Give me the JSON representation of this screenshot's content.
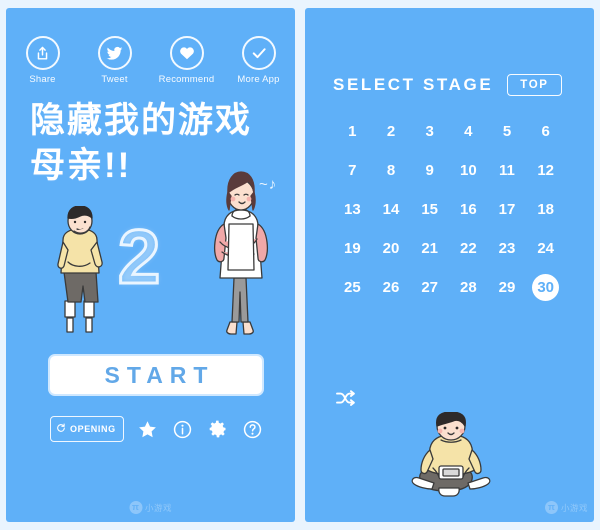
{
  "colors": {
    "background": "#5fb0f8",
    "page_background": "#e9f4fe",
    "accent_white": "#ffffff",
    "start_text": "#62a8e8",
    "selected_stage_text": "#5fb0f8"
  },
  "left_screen": {
    "social": [
      {
        "label": "Share",
        "icon": "share-upload-icon"
      },
      {
        "label": "Tweet",
        "icon": "twitter-bird-icon"
      },
      {
        "label": "Recommend",
        "icon": "heart-icon"
      },
      {
        "label": "More App",
        "icon": "check-circle-icon"
      }
    ],
    "title_line_1": "隐藏我的游戏",
    "title_line_2": "母亲!!",
    "sequel_number": "2",
    "music_note": "~♪",
    "start_label": "START",
    "bottom_bar": {
      "opening_label": "OPENING",
      "opening_icon": "refresh-icon",
      "icons": [
        {
          "name": "star-icon"
        },
        {
          "name": "info-icon"
        },
        {
          "name": "gear-icon"
        },
        {
          "name": "help-question-icon"
        }
      ]
    },
    "characters": [
      {
        "name": "boy-thinking-illustration"
      },
      {
        "name": "mother-apron-illustration"
      }
    ]
  },
  "right_screen": {
    "header_title": "SELECT STAGE",
    "top_button_label": "TOP",
    "stages": [
      {
        "number": "1",
        "selected": false
      },
      {
        "number": "2",
        "selected": false
      },
      {
        "number": "3",
        "selected": false
      },
      {
        "number": "4",
        "selected": false
      },
      {
        "number": "5",
        "selected": false
      },
      {
        "number": "6",
        "selected": false
      },
      {
        "number": "7",
        "selected": false
      },
      {
        "number": "8",
        "selected": false
      },
      {
        "number": "9",
        "selected": false
      },
      {
        "number": "10",
        "selected": false
      },
      {
        "number": "11",
        "selected": false
      },
      {
        "number": "12",
        "selected": false
      },
      {
        "number": "13",
        "selected": false
      },
      {
        "number": "14",
        "selected": false
      },
      {
        "number": "15",
        "selected": false
      },
      {
        "number": "16",
        "selected": false
      },
      {
        "number": "17",
        "selected": false
      },
      {
        "number": "18",
        "selected": false
      },
      {
        "number": "19",
        "selected": false
      },
      {
        "number": "20",
        "selected": false
      },
      {
        "number": "21",
        "selected": false
      },
      {
        "number": "22",
        "selected": false
      },
      {
        "number": "23",
        "selected": false
      },
      {
        "number": "24",
        "selected": false
      },
      {
        "number": "25",
        "selected": false
      },
      {
        "number": "26",
        "selected": false
      },
      {
        "number": "27",
        "selected": false
      },
      {
        "number": "28",
        "selected": false
      },
      {
        "number": "29",
        "selected": false
      },
      {
        "number": "30",
        "selected": true
      }
    ],
    "shuffle_icon": "shuffle-icon",
    "characters": [
      {
        "name": "boy-sitting-handheld-illustration"
      }
    ]
  },
  "watermark": {
    "logo": "π",
    "text": "小游戏"
  }
}
